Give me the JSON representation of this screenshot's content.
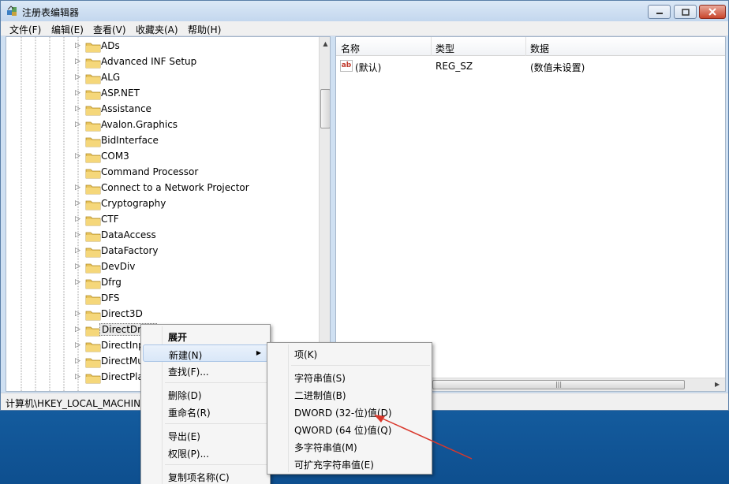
{
  "window": {
    "title": "注册表编辑器",
    "min_icon": "minimize-icon",
    "max_icon": "maximize-icon",
    "close_icon": "close-icon"
  },
  "menubar": [
    "文件(F)",
    "编辑(E)",
    "查看(V)",
    "收藏夹(A)",
    "帮助(H)"
  ],
  "tree": {
    "items": [
      {
        "label": "ADs",
        "expandable": true
      },
      {
        "label": "Advanced INF Setup",
        "expandable": true
      },
      {
        "label": "ALG",
        "expandable": true
      },
      {
        "label": "ASP.NET",
        "expandable": true
      },
      {
        "label": "Assistance",
        "expandable": true
      },
      {
        "label": "Avalon.Graphics",
        "expandable": true
      },
      {
        "label": "BidInterface",
        "expandable": false
      },
      {
        "label": "COM3",
        "expandable": true
      },
      {
        "label": "Command Processor",
        "expandable": false
      },
      {
        "label": "Connect to a Network Projector",
        "expandable": true
      },
      {
        "label": "Cryptography",
        "expandable": true
      },
      {
        "label": "CTF",
        "expandable": true
      },
      {
        "label": "DataAccess",
        "expandable": true
      },
      {
        "label": "DataFactory",
        "expandable": true
      },
      {
        "label": "DevDiv",
        "expandable": true
      },
      {
        "label": "Dfrg",
        "expandable": true
      },
      {
        "label": "DFS",
        "expandable": false
      },
      {
        "label": "Direct3D",
        "expandable": true
      },
      {
        "label": "DirectDraw",
        "expandable": true,
        "selected": true
      },
      {
        "label": "DirectInput",
        "expandable": true
      },
      {
        "label": "DirectMusic",
        "expandable": true
      },
      {
        "label": "DirectPlay",
        "expandable": true
      }
    ]
  },
  "list": {
    "columns": [
      "名称",
      "类型",
      "数据"
    ],
    "rows": [
      {
        "name": "(默认)",
        "type": "REG_SZ",
        "data": "(数值未设置)",
        "icon": "string-value-icon"
      }
    ]
  },
  "statusbar": {
    "path": "计算机\\HKEY_LOCAL_MACHIN"
  },
  "context_menu": {
    "items": [
      "展开",
      "新建(N)",
      "查找(F)...",
      "删除(D)",
      "重命名(R)",
      "导出(E)",
      "权限(P)...",
      "复制项名称(C)"
    ],
    "hot_index": 1
  },
  "submenu": {
    "items": [
      "项(K)",
      "字符串值(S)",
      "二进制值(B)",
      "DWORD (32-位)值(D)",
      "QWORD (64 位)值(Q)",
      "多字符串值(M)",
      "可扩充字符串值(E)"
    ]
  },
  "colors": {
    "titlebar": "#c3d7ee",
    "annotation_arrow": "#d9372b",
    "selection": "#d9e7f8"
  }
}
